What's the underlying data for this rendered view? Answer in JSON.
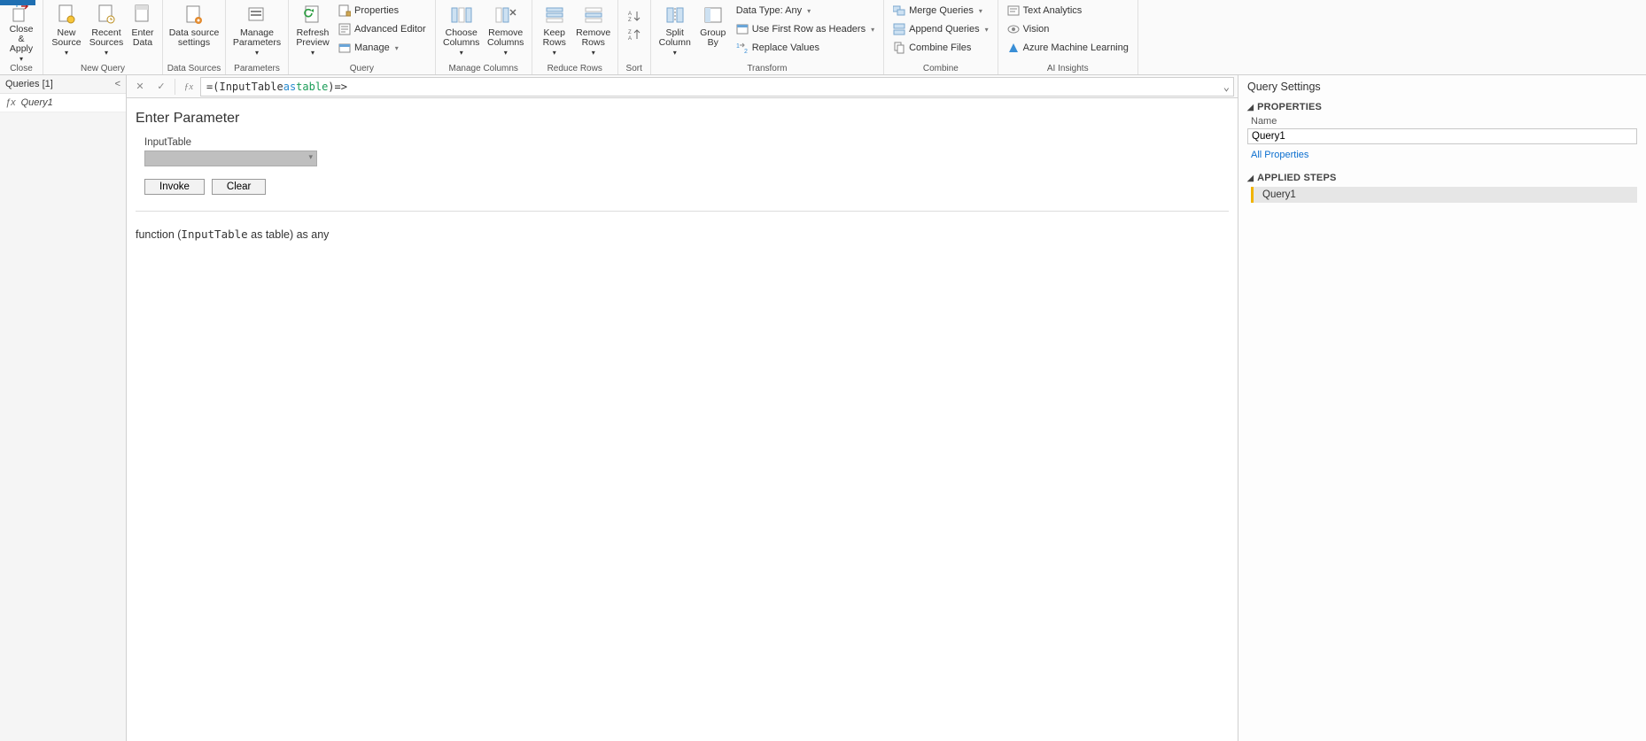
{
  "ribbon": {
    "close_group": {
      "label": "Close",
      "close_apply": "Close &\nApply"
    },
    "new_query_group": {
      "label": "New Query",
      "new_source": "New\nSource",
      "recent_sources": "Recent\nSources",
      "enter_data": "Enter\nData"
    },
    "data_sources_group": {
      "label": "Data Sources",
      "data_source_settings": "Data source\nsettings"
    },
    "parameters_group": {
      "label": "Parameters",
      "manage_parameters": "Manage\nParameters"
    },
    "query_group": {
      "label": "Query",
      "refresh_preview": "Refresh\nPreview",
      "properties": "Properties",
      "advanced_editor": "Advanced Editor",
      "manage": "Manage"
    },
    "manage_columns_group": {
      "label": "Manage Columns",
      "choose_columns": "Choose\nColumns",
      "remove_columns": "Remove\nColumns"
    },
    "reduce_rows_group": {
      "label": "Reduce Rows",
      "keep_rows": "Keep\nRows",
      "remove_rows": "Remove\nRows"
    },
    "sort_group": {
      "label": "Sort"
    },
    "transform_group": {
      "label": "Transform",
      "split_column": "Split\nColumn",
      "group_by": "Group\nBy",
      "data_type": "Data Type: Any",
      "first_row_headers": "Use First Row as Headers",
      "replace_values": "Replace Values"
    },
    "combine_group": {
      "label": "Combine",
      "merge_queries": "Merge Queries",
      "append_queries": "Append Queries",
      "combine_files": "Combine Files"
    },
    "ai_group": {
      "label": "AI Insights",
      "text_analytics": "Text Analytics",
      "vision": "Vision",
      "azure_ml": "Azure Machine Learning"
    }
  },
  "left": {
    "header": "Queries [1]",
    "items": [
      "Query1"
    ]
  },
  "formula": {
    "eq": "= ",
    "p1": "(",
    "ident": "InputTable",
    "space1": " ",
    "kw_as": "as",
    "space2": " ",
    "type_table": "table",
    "p2": ")",
    "tail": " =>"
  },
  "main": {
    "title": "Enter Parameter",
    "param_label": "InputTable",
    "invoke": "Invoke",
    "clear": "Clear",
    "sig_prefix": "function (",
    "sig_mono": "InputTable",
    "sig_suffix": " as table) as any"
  },
  "right": {
    "title": "Query Settings",
    "properties_hdr": "PROPERTIES",
    "name_label": "Name",
    "name_value": "Query1",
    "all_properties": "All Properties",
    "applied_steps_hdr": "APPLIED STEPS",
    "steps": [
      "Query1"
    ]
  }
}
